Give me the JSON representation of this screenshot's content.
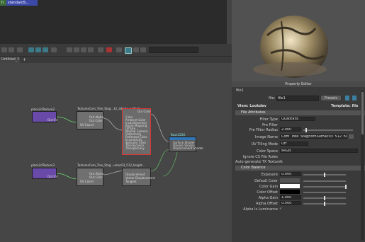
{
  "top_tags": {
    "a": "h",
    "b": "standardS..."
  },
  "tab": {
    "label": "Untitled_1",
    "add": "+"
  },
  "search": {
    "placeholder": ""
  },
  "nodes": {
    "place2d_1": {
      "title": "place2dTexture2",
      "attrs": [
        "Out UV"
      ]
    },
    "file_1": {
      "title": "TexturesCom_Tree_Stag...12_albedo_s_Mask",
      "attrs": [
        "Out Alpha",
        "Out Color",
        "UV Coord"
      ]
    },
    "shader": {
      "title": "standardSurface",
      "attrs": [
        "Out Color",
        "Color",
        "Ambient Color",
        "Incandescence",
        "Bump Mapping",
        "Diffuse",
        "Normal Camera",
        "Reflectivity",
        "Reflected Color",
        "Eccentricity",
        "Specular Color",
        "Translucence",
        "Transparency"
      ]
    },
    "sg": {
      "title": "Base12SG",
      "attrs": [
        "Surface Shader",
        "Volume Shader",
        "Displacement Shader"
      ]
    },
    "place2d_2": {
      "title": "place2dTexture3",
      "attrs": [
        "Out UV"
      ]
    },
    "file_2": {
      "title": "TexturesCom_Tree_Stag...umac03_512_height...",
      "attrs": [
        "Out Alpha",
        "Out Color",
        "UV Coord"
      ]
    },
    "disp": {
      "title": "displacementShader1",
      "attrs": [
        "Displacement",
        "Vector Displacement",
        "Tangent"
      ]
    }
  },
  "property_editor": {
    "title": "Property Editor",
    "node_name": "file1",
    "file_label": "file:",
    "file_value": "file1",
    "presets_label": "Presets",
    "view_label": "View: Lookdev",
    "template_label": "Template: file",
    "sections": {
      "file_attributes": "File Attributes",
      "color_balance": "Color Balance"
    },
    "file_attrs": {
      "filter_type_label": "Filter Type",
      "filter_type_value": "Quadratic",
      "pre_filter_label": "Pre Filter",
      "pre_filter_radius_label": "Pre Filter Radius",
      "pre_filter_radius_value": "2.000",
      "image_name_label": "Image Name",
      "image_name_value": "Com_Tree_StaghornSumac03_512_height.tif",
      "uv_tiling_label": "UV Tiling Mode",
      "uv_tiling_value": "Off",
      "color_space_label": "Color Space",
      "color_space_value": "sRGB",
      "ignore_cs_label": "Ignore CS File Rules",
      "auto_tx_label": "Auto-generate TX Textures",
      "check": "✓"
    },
    "color_balance": {
      "exposure_label": "Exposure",
      "exposure_value": "0.000",
      "default_color_label": "Default Color",
      "color_gain_label": "Color Gain",
      "color_offset_label": "Color Offset",
      "alpha_gain_label": "Alpha Gain",
      "alpha_gain_value": "1.000",
      "alpha_offset_label": "Alpha Offset",
      "alpha_offset_value": "0.000",
      "alpha_lum_label": "Alpha Is Luminance",
      "check": "✓"
    }
  },
  "colors": {
    "file_node": "#707070",
    "place2d": "#6a4aa8",
    "shader_header": "#b03030",
    "sg_header": "#2f76b8"
  }
}
